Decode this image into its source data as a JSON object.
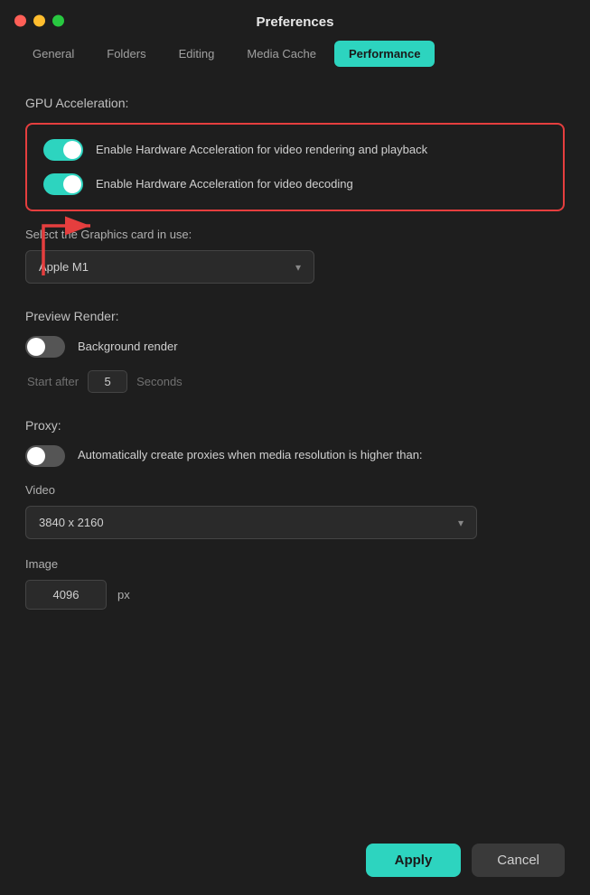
{
  "window": {
    "title": "Preferences"
  },
  "tabs": [
    {
      "label": "General",
      "id": "general",
      "active": false
    },
    {
      "label": "Folders",
      "id": "folders",
      "active": false
    },
    {
      "label": "Editing",
      "id": "editing",
      "active": false
    },
    {
      "label": "Media Cache",
      "id": "media-cache",
      "active": false
    },
    {
      "label": "Performance",
      "id": "performance",
      "active": true
    }
  ],
  "gpu_section": {
    "title": "GPU Acceleration:",
    "toggle1": {
      "label": "Enable Hardware Acceleration for video rendering and playback",
      "enabled": true
    },
    "toggle2": {
      "label": "Enable Hardware Acceleration for video decoding",
      "enabled": true
    },
    "select_label": "Select the Graphics card in use:",
    "graphics_card": "Apple M1"
  },
  "preview_render": {
    "title": "Preview Render:",
    "background_render": {
      "label": "Background render",
      "enabled": false
    },
    "start_after_label": "Start after",
    "start_after_value": "5",
    "seconds_label": "Seconds"
  },
  "proxy": {
    "title": "Proxy:",
    "auto_create": {
      "label": "Automatically create proxies when media resolution is higher than:",
      "enabled": false
    },
    "video_label": "Video",
    "video_resolution": "3840 x 2160",
    "image_label": "Image",
    "image_value": "4096",
    "px_label": "px"
  },
  "buttons": {
    "apply": "Apply",
    "cancel": "Cancel"
  }
}
